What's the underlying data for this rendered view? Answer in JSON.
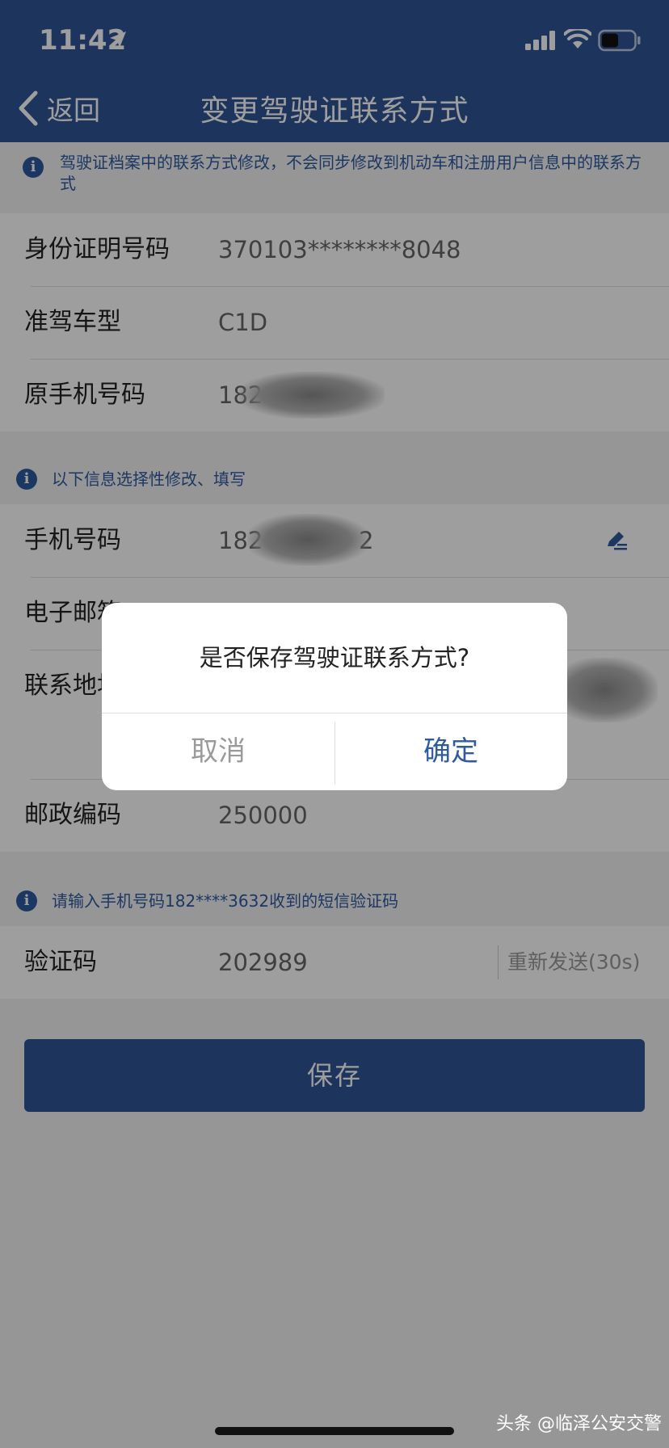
{
  "status_bar": {
    "time": "11:42",
    "icons": [
      "location-arrow-icon",
      "signal-icon",
      "wifi-icon",
      "battery-icon"
    ]
  },
  "navbar": {
    "back_label": "返回",
    "title": "变更驾驶证联系方式",
    "background": "#2f5597"
  },
  "notices": {
    "top": "驾驶证档案中的联系方式修改，不会同步修改到机动车和注册用户信息中的联系方式",
    "optional": "以下信息选择性修改、填写",
    "sms": "请输入手机号码182****3632收到的短信验证码"
  },
  "readonly_info": {
    "rows": [
      {
        "label": "身份证明号码",
        "value": "370103********8048"
      },
      {
        "label": "准驾车型",
        "value": "C1D"
      },
      {
        "label": "原手机号码",
        "value": "182"
      }
    ]
  },
  "editable_info": {
    "phone": {
      "label": "手机号码",
      "value": "182",
      "trail": "2"
    },
    "email": {
      "label": "电子邮箱"
    },
    "address": {
      "label": "联系地址"
    },
    "postal": {
      "label": "邮政编码",
      "value": "250000"
    }
  },
  "verification": {
    "label": "验证码",
    "value": "202989",
    "resend_label": "重新发送(30s)"
  },
  "save_button": {
    "label": "保存"
  },
  "dialog": {
    "message": "是否保存驾驶证联系方式?",
    "cancel_label": "取消",
    "confirm_label": "确定"
  },
  "watermark": "头条 @临泽公安交警",
  "colors": {
    "brand": "#2f5597",
    "link": "#2f5aa1",
    "overlay": "rgba(0,0,0,0.38)"
  }
}
